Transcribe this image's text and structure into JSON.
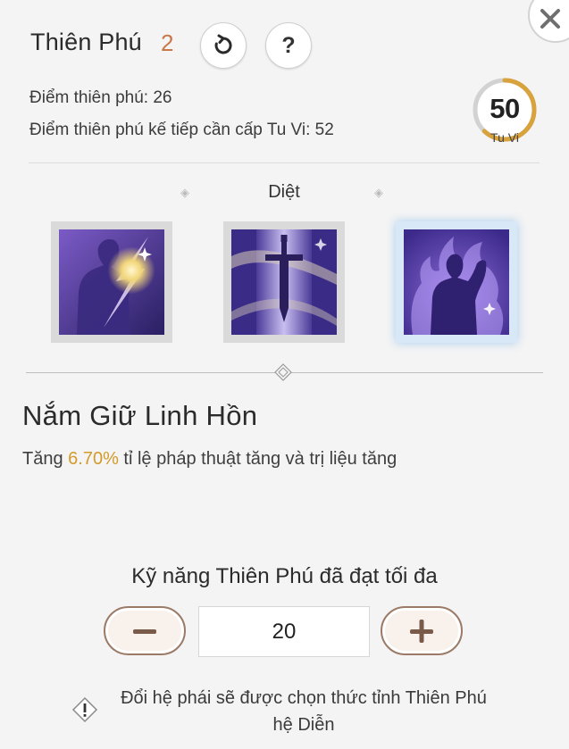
{
  "header": {
    "title": "Thiên Phú",
    "count": "2",
    "reset_icon": "reset-icon",
    "help_label": "?",
    "close_icon": "close-icon"
  },
  "stats": {
    "points": "Điểm thiên phú: 26",
    "next_requirement": "Điểm thiên phú kế tiếp cần cấp Tu Vi: 52"
  },
  "level": {
    "value": "50",
    "caption": "Tu Vi",
    "progress": 0.62,
    "colors": {
      "track": "#d2d2d2",
      "fill": "#d8a23d"
    }
  },
  "tree": {
    "label": "Diệt",
    "skills": [
      {
        "icon": "soul-strike-icon",
        "selected": false
      },
      {
        "icon": "sword-icon",
        "selected": false
      },
      {
        "icon": "flame-body-icon",
        "selected": true
      }
    ]
  },
  "detail": {
    "name": "Nắm Giữ Linh Hồn",
    "desc_prefix": "Tăng ",
    "desc_value": "6.70%",
    "desc_suffix": " tỉ lệ pháp thuật tăng và trị liệu tăng",
    "highlight_color": "#d39a2a"
  },
  "footer": {
    "max_text": "Kỹ năng Thiên Phú đã đạt tối đa",
    "quantity": "20",
    "note_line1": "Đổi hệ phái sẽ được chọn thức tỉnh Thiên Phú",
    "note_line2": "hệ Diễn"
  }
}
